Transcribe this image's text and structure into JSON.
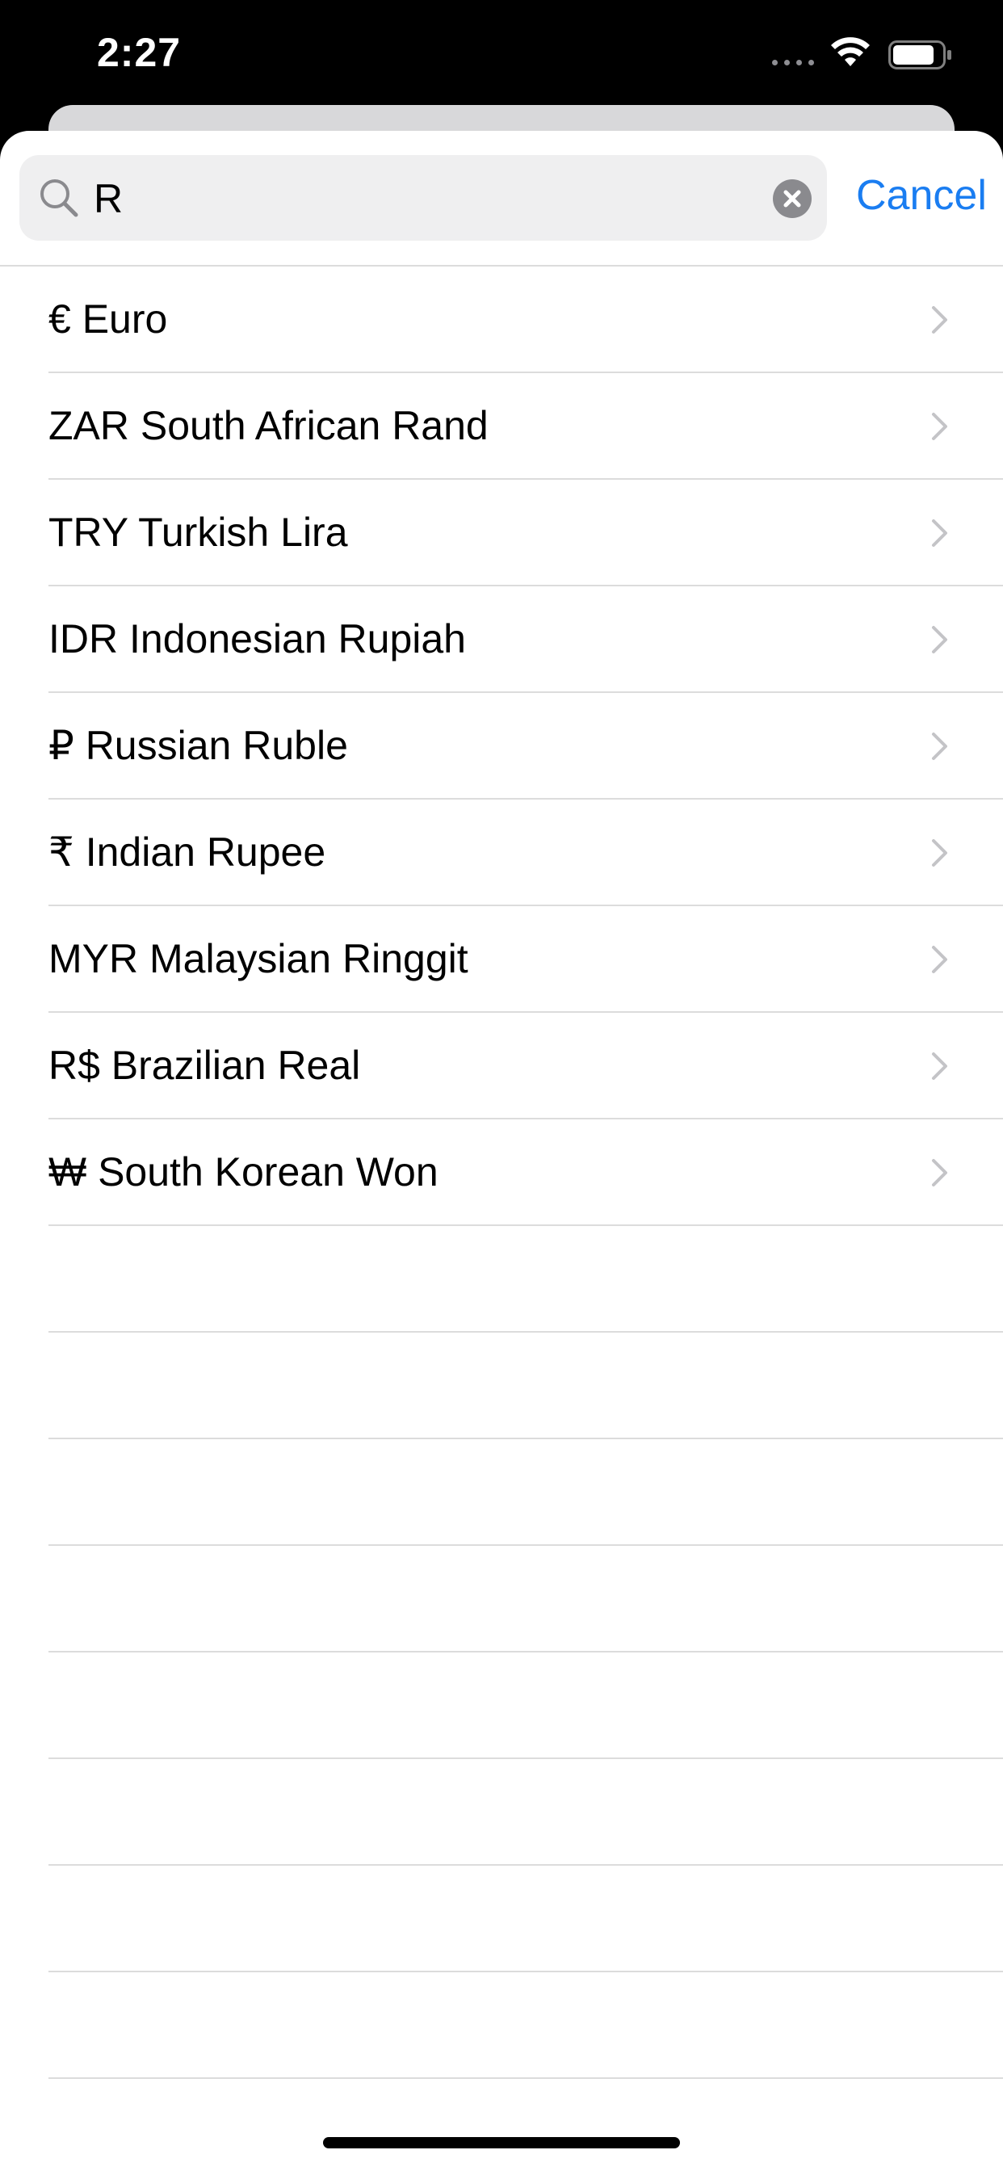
{
  "status_bar": {
    "time": "2:27"
  },
  "search": {
    "value": "R",
    "cancel_label": "Cancel"
  },
  "currencies": [
    {
      "label": "€ Euro"
    },
    {
      "label": "ZAR South African Rand"
    },
    {
      "label": "TRY Turkish Lira"
    },
    {
      "label": "IDR Indonesian Rupiah"
    },
    {
      "label": "₽ Russian Ruble"
    },
    {
      "label": "₹ Indian Rupee"
    },
    {
      "label": "MYR Malaysian Ringgit"
    },
    {
      "label": "R$ Brazilian Real"
    },
    {
      "label": "₩ South Korean Won"
    }
  ],
  "colors": {
    "accent": "#1a7df1",
    "separator": "#dcdcdc",
    "search_bg": "#efeff0"
  },
  "icons": [
    "search-icon",
    "clear-icon",
    "chevron-right-icon",
    "wifi-icon",
    "battery-icon",
    "signal-icon"
  ]
}
